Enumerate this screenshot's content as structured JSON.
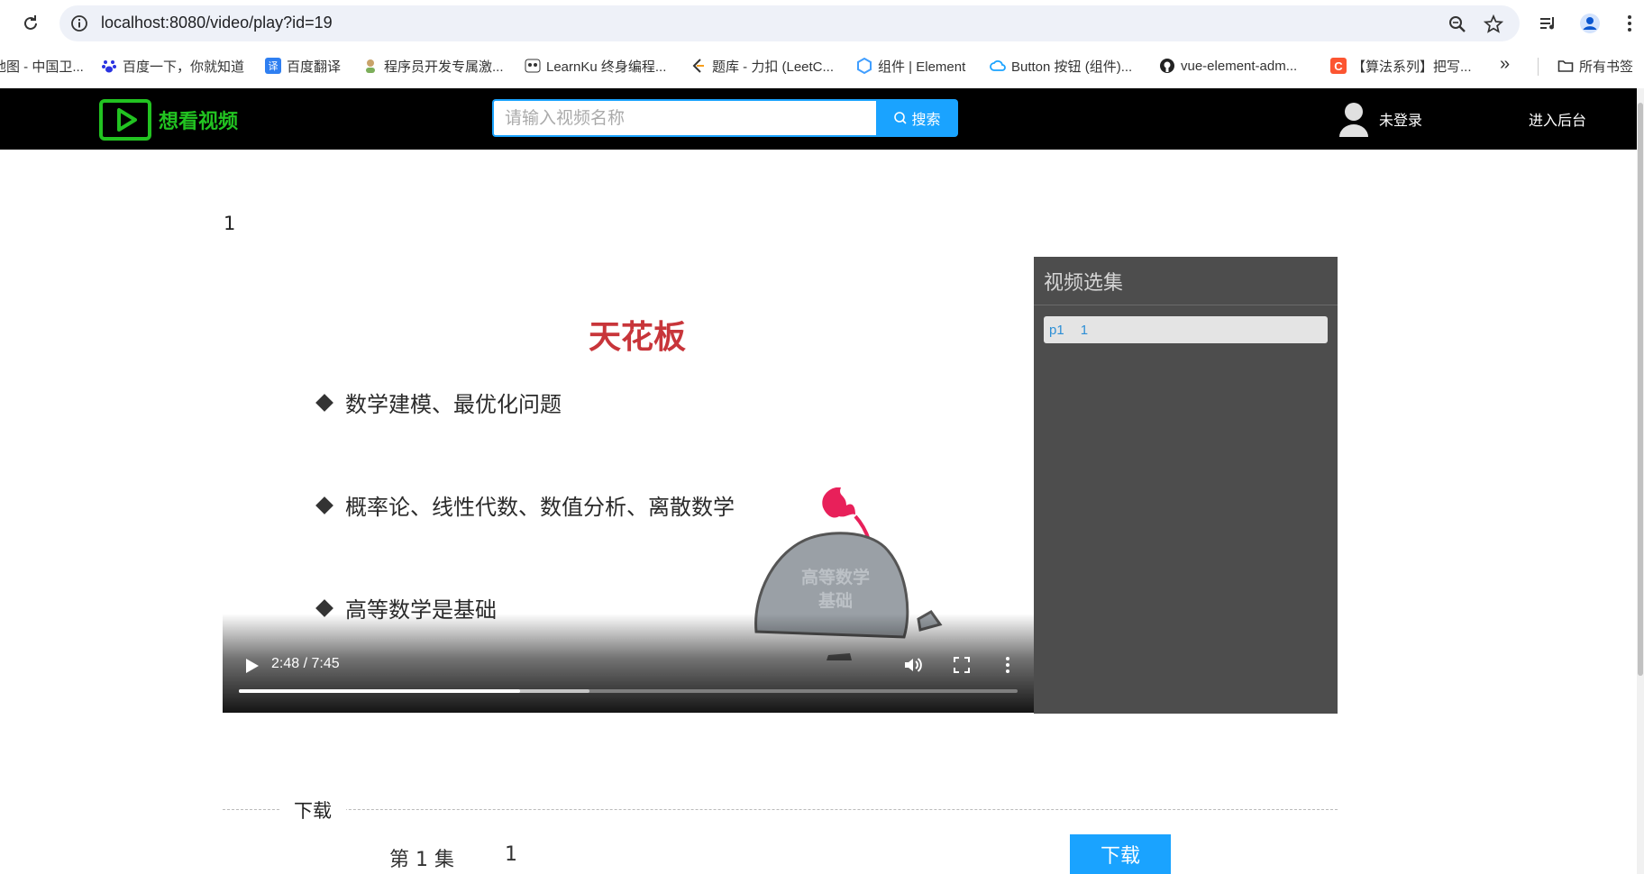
{
  "browser": {
    "url": "localhost:8080/video/play?id=19",
    "bookmarks": [
      {
        "label": "地图 - 中国卫...",
        "icon": "map-favicon"
      },
      {
        "label": "百度一下，你就知道",
        "icon": "baidu-favicon"
      },
      {
        "label": "百度翻译",
        "icon": "translate-favicon"
      },
      {
        "label": "程序员开发专属激...",
        "icon": "profile-favicon"
      },
      {
        "label": "LearnKu 终身编程...",
        "icon": "panda-favicon"
      },
      {
        "label": "题库 - 力扣 (LeetC...",
        "icon": "leetcode-favicon"
      },
      {
        "label": "组件 | Element",
        "icon": "element-favicon"
      },
      {
        "label": "Button 按钮 (组件)...",
        "icon": "cloud-favicon"
      },
      {
        "label": "vue-element-adm...",
        "icon": "github-favicon"
      },
      {
        "label": "【算法系列】把写...",
        "icon": "csdn-favicon"
      }
    ],
    "more_bookmarks": "»",
    "all_bookmarks": "所有书签"
  },
  "header": {
    "logo_text": "想看视频",
    "search_placeholder": "请输入视频名称",
    "search_button": "搜索",
    "user_status": "未登录",
    "admin_link": "进入后台",
    "brand_color": "#22c321",
    "accent_color": "#1aa3ff"
  },
  "video": {
    "title": "1",
    "slide": {
      "heading": "天花板",
      "bullets": [
        "数学建模、最优化问题",
        "概率论、线性代数、数值分析、离散数学",
        "高等数学是基础"
      ],
      "rock_text_line1": "高等数学",
      "rock_text_line2": "基础"
    },
    "current_time": "2:48",
    "duration": "7:45",
    "time_display": "2:48 / 7:45",
    "progress": 0.3613,
    "buffered": 0.45
  },
  "episodes": {
    "header": "视频选集",
    "items": [
      {
        "code": "p1",
        "name": "1"
      }
    ]
  },
  "download": {
    "section_label": "下载",
    "rows": [
      {
        "label": "第 1 集",
        "name": "1",
        "button": "下载"
      }
    ]
  }
}
